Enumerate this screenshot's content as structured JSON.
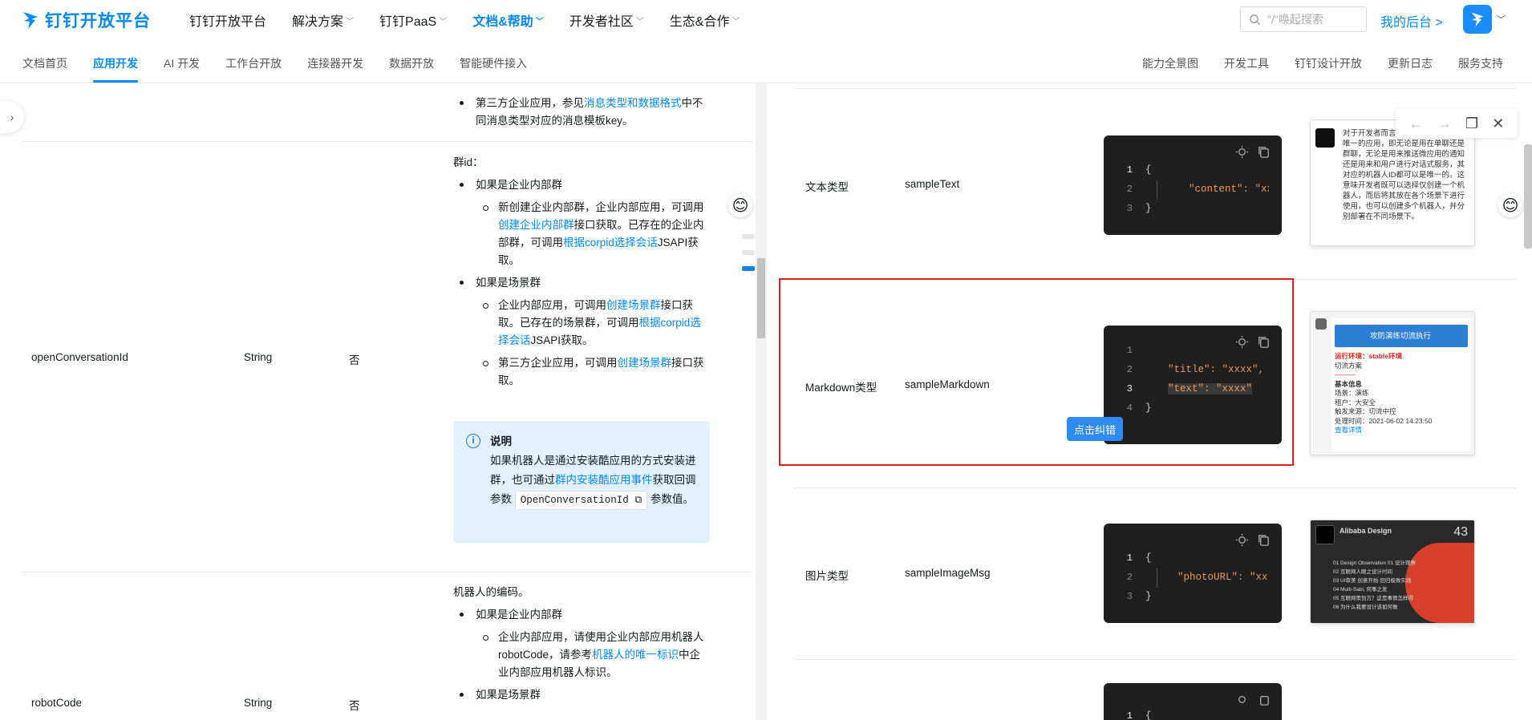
{
  "header": {
    "logo_text": "钉钉开放平台",
    "nav": [
      {
        "label": "钉钉开放平台",
        "caret": false,
        "active": false
      },
      {
        "label": "解决方案",
        "caret": true,
        "active": false
      },
      {
        "label": "钉钉PaaS",
        "caret": true,
        "active": false
      },
      {
        "label": "文档&帮助",
        "caret": true,
        "active": true
      },
      {
        "label": "开发者社区",
        "caret": true,
        "active": false
      },
      {
        "label": "生态&合作",
        "caret": true,
        "active": false
      }
    ],
    "search_placeholder": "\"/\"唤起搜索",
    "my_backend": "我的后台 >"
  },
  "subnav": {
    "left": [
      "文档首页",
      "应用开发",
      "AI 开发",
      "工作台开放",
      "连接器开发",
      "数据开放",
      "智能硬件接入"
    ],
    "active": "应用开发",
    "right": [
      "能力全景图",
      "开发工具",
      "钉钉设计开放",
      "更新日志",
      "服务支持"
    ]
  },
  "left_table": {
    "top_item": {
      "text_before": "第三方企业应用，参见",
      "link": "消息类型和数据格式",
      "text_after": "中不同消息类型对应的消息模板key。"
    },
    "row1": {
      "name": "openConversationId",
      "type": "String",
      "required": "否",
      "intro": "群id：",
      "case1": "如果是企业内部群",
      "case1_sub": {
        "t1": "新创建企业内部群，企业内部应用，可调用",
        "l1": "创建企业内部群",
        "t2": "接口获取。已存在的企业内部群，可调用",
        "l2": "根据corpid选择会话",
        "t3": "JSAPI获取。"
      },
      "case2": "如果是场景群",
      "case2_sub1": {
        "t1": "企业内部应用，可调用",
        "l1": "创建场景群",
        "t2": "接口获取。已存在的场景群，可调用",
        "l2": "根据corpid选择会话",
        "t3": "JSAPI获取。"
      },
      "case2_sub2": {
        "t1": "第三方企业应用，可调用",
        "l1": "创建场景群",
        "t2": "接口获取。"
      },
      "note_title": "说明",
      "note_t1": "如果机器人是通过安装酷应用的方式安装进群，也可通过",
      "note_link": "群内安装酷应用事件",
      "note_t2": "获取回调参数",
      "note_code": "OpenConversationId",
      "note_t3": "参数值。"
    },
    "row2": {
      "name": "robotCode",
      "type": "String",
      "required": "否",
      "intro": "机器人的编码。",
      "case1": "如果是企业内部群",
      "case1_sub": {
        "t1": "企业内部应用，请使用企业内部应用机器人robotCode，请参考",
        "l1": "机器人的唯一标识",
        "t2": "中企业内部应用机器人标识。"
      },
      "case2": "如果是场景群"
    }
  },
  "right_table": {
    "rows": [
      {
        "type": "文本类型",
        "key": "sampleText",
        "code": [
          "{",
          "\"content\": \"xx",
          "}"
        ]
      },
      {
        "type": "Markdown类型",
        "key": "sampleMarkdown",
        "code": [
          "",
          "\"title\": \"xxxx\",",
          "\"text\": \"xxxx\"",
          "}"
        ]
      },
      {
        "type": "图片类型",
        "key": "sampleImageMsg",
        "code": [
          "{",
          "\"photoURL\": \"xx",
          "}"
        ]
      }
    ],
    "fix_button": "点击纠错",
    "thumb1_text": "对于开发者而言，钉钉机器人是全局唯一的应用，即无论是用在单聊还是群聊，无论是用来推送微应用的通知还是用来和用户进行对话式服务，其对应的机器人ID都可以是唯一的。这意味开发者既可以选择仅创建一个机器人，而后将其放在各个场景下进行使用，也可以创建多个机器人，并分别部署在不同场景下。",
    "thumb2": {
      "banner": "攻防演练切流执行",
      "env": "运行环境：stable环境",
      "plan": "切流方案",
      "base": "基本信息",
      "f1": "场景：演练",
      "f2": "租户：大安全",
      "f3": "触发来源：切流中控",
      "f4": "处理时间：2021-06-02 14:23:50",
      "more": "查看详情"
    },
    "thumb3": {
      "brand": "Alibaba Design",
      "num": "43",
      "lines": [
        "01 Design Observation 01 设计观察",
        "02 互联网人眼之设计时间",
        "03 UI审美 创意开始·回归极致实践",
        "04 Multi-Sabi, 何事之发",
        "05 互联网策划方？这是事情怎样得",
        "06 为什么我要设计该如何做"
      ]
    }
  },
  "colors": {
    "accent": "#0089ff",
    "highlight": "#e02020",
    "code_bg": "#1f1f1f",
    "note_bg": "#e3f1ff"
  }
}
